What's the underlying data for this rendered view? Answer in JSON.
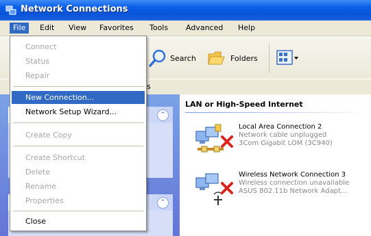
{
  "window": {
    "title": "Network Connections"
  },
  "menubar": {
    "items": [
      {
        "label": "File",
        "active": true
      },
      {
        "label": "Edit"
      },
      {
        "label": "View"
      },
      {
        "label": "Favorites"
      },
      {
        "label": "Tools"
      },
      {
        "label": "Advanced"
      },
      {
        "label": "Help"
      }
    ]
  },
  "toolbar": {
    "search_label": "Search",
    "folders_label": "Folders"
  },
  "address": {
    "tail_text": "s"
  },
  "file_menu": {
    "items": [
      {
        "label": "Connect",
        "enabled": false
      },
      {
        "label": "Status",
        "enabled": false
      },
      {
        "label": "Repair",
        "enabled": false
      },
      {
        "label": "New Connection...",
        "enabled": true,
        "selected": true
      },
      {
        "label": "Network Setup Wizard...",
        "enabled": true
      },
      {
        "label": "Create Copy",
        "enabled": false
      },
      {
        "label": "Create Shortcut",
        "enabled": false
      },
      {
        "label": "Delete",
        "enabled": false
      },
      {
        "label": "Rename",
        "enabled": false
      },
      {
        "label": "Properties",
        "enabled": false
      },
      {
        "label": "Close",
        "enabled": true
      }
    ]
  },
  "content": {
    "group_title": "LAN or High-Speed Internet",
    "connections": [
      {
        "name": "Local Area Connection 2",
        "status": "Network cable unplugged",
        "device": "3Com Gigabit LOM (3C940)",
        "icon": "lan-connection-icon"
      },
      {
        "name": "Wireless Network Connection 3",
        "status": "Wireless connection unavailable",
        "device": "ASUS 802.11b Network Adapt...",
        "icon": "wireless-connection-icon"
      }
    ]
  },
  "colors": {
    "titlebar": "#0a54d8",
    "selection": "#316ac5",
    "disabled_text": "#a7a7a7",
    "error_x": "#d8241c"
  }
}
